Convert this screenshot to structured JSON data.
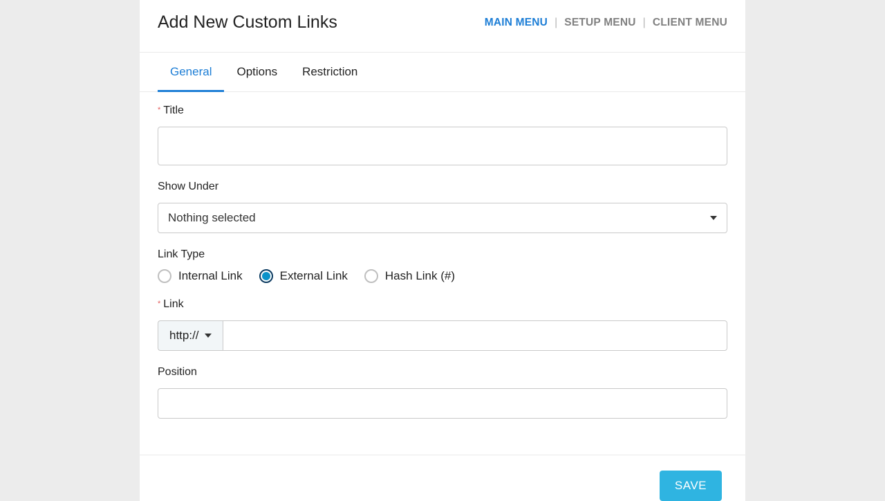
{
  "header": {
    "title": "Add New Custom Links",
    "nav": [
      {
        "label": "MAIN MENU",
        "active": true
      },
      {
        "label": "SETUP MENU",
        "active": false
      },
      {
        "label": "CLIENT MENU",
        "active": false
      }
    ]
  },
  "tabs": [
    {
      "label": "General",
      "active": true
    },
    {
      "label": "Options",
      "active": false
    },
    {
      "label": "Restriction",
      "active": false
    }
  ],
  "form": {
    "required_marker": "*",
    "title_label": "Title",
    "title_value": "",
    "show_under_label": "Show Under",
    "show_under_selected": "Nothing selected",
    "link_type_label": "Link Type",
    "link_type_options": [
      {
        "label": "Internal Link",
        "checked": false
      },
      {
        "label": "External Link",
        "checked": true
      },
      {
        "label": "Hash Link (#)",
        "checked": false
      }
    ],
    "link_label": "Link",
    "link_protocol": "http://",
    "link_value": "",
    "position_label": "Position",
    "position_value": ""
  },
  "actions": {
    "save_label": "SAVE"
  }
}
